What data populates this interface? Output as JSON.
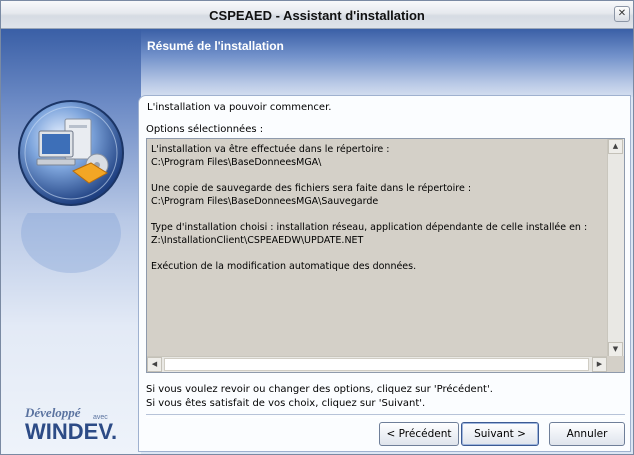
{
  "window": {
    "title": "CSPEAED - Assistant d'installation",
    "close_glyph": "✕"
  },
  "header": {
    "step_title": "Résumé de l'installation"
  },
  "main": {
    "intro": "L'installation va pouvoir commencer.",
    "options_label": "Options sélectionnées :",
    "summary_text": "L'installation va être effectuée dans le répertoire :\nC:\\Program Files\\BaseDonneesMGA\\\n\nUne copie de sauvegarde des fichiers sera faite dans le répertoire :\nC:\\Program Files\\BaseDonneesMGA\\Sauvegarde\n\nType d'installation choisi : installation réseau, application dépendante de celle installée en :\nZ:\\InstallationClient\\CSPEAEDW\\UPDATE.NET\n\nExécution de la modification automatique des données.",
    "help_line1": "Si vous voulez revoir ou changer des options, cliquez sur 'Précédent'.",
    "help_line2": "Si vous êtes satisfait de vos choix, cliquez sur 'Suivant'."
  },
  "buttons": {
    "previous": "< Précédent",
    "next": "Suivant >",
    "cancel": "Annuler"
  },
  "branding": {
    "developed": "Développé",
    "with": "avec",
    "product": "WINDEV."
  },
  "icons": [
    "computer-install-icon",
    "close-icon",
    "scroll-up-icon",
    "scroll-down-icon",
    "scroll-left-icon",
    "scroll-right-icon"
  ]
}
